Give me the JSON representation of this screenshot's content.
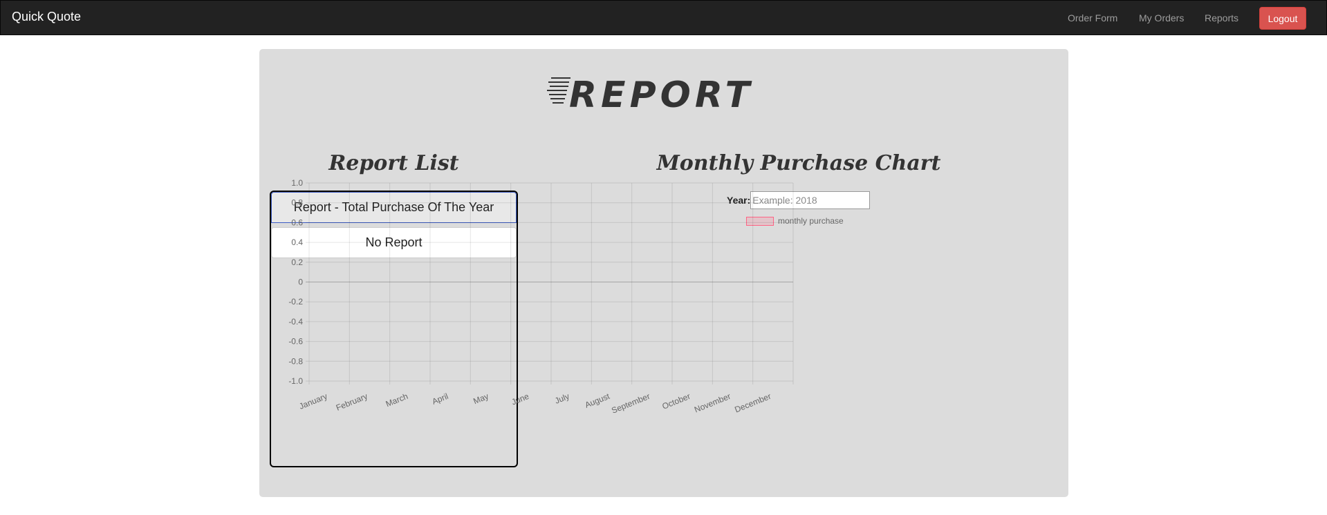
{
  "navbar": {
    "brand": "Quick Quote",
    "links": [
      "Order Form",
      "My Orders",
      "Reports"
    ],
    "logout": "Logout",
    "logout_color": "#d9534f"
  },
  "page": {
    "banner": "REPORT",
    "report_list_title": "Report List",
    "chart_title": "Monthly Purchase Chart",
    "report_items": [
      "Report - Total Purchase Of The Year",
      "No Report"
    ],
    "year_label": "Year:",
    "year_value": "",
    "year_placeholder": "Example: 2018"
  },
  "chart_data": {
    "type": "bar",
    "categories": [
      "January",
      "February",
      "March",
      "April",
      "May",
      "June",
      "July",
      "August",
      "September",
      "October",
      "November",
      "December"
    ],
    "series": [
      {
        "name": "monthly purchase",
        "values": [],
        "color": "#ff6384"
      }
    ],
    "ylim": [
      -1.0,
      1.0
    ],
    "yticks": [
      "1.0",
      "0.8",
      "0.6",
      "0.4",
      "0.2",
      "0",
      "-0.2",
      "-0.4",
      "-0.6",
      "-0.8",
      "-1.0"
    ],
    "legend_position": "top-center",
    "grid": true
  }
}
